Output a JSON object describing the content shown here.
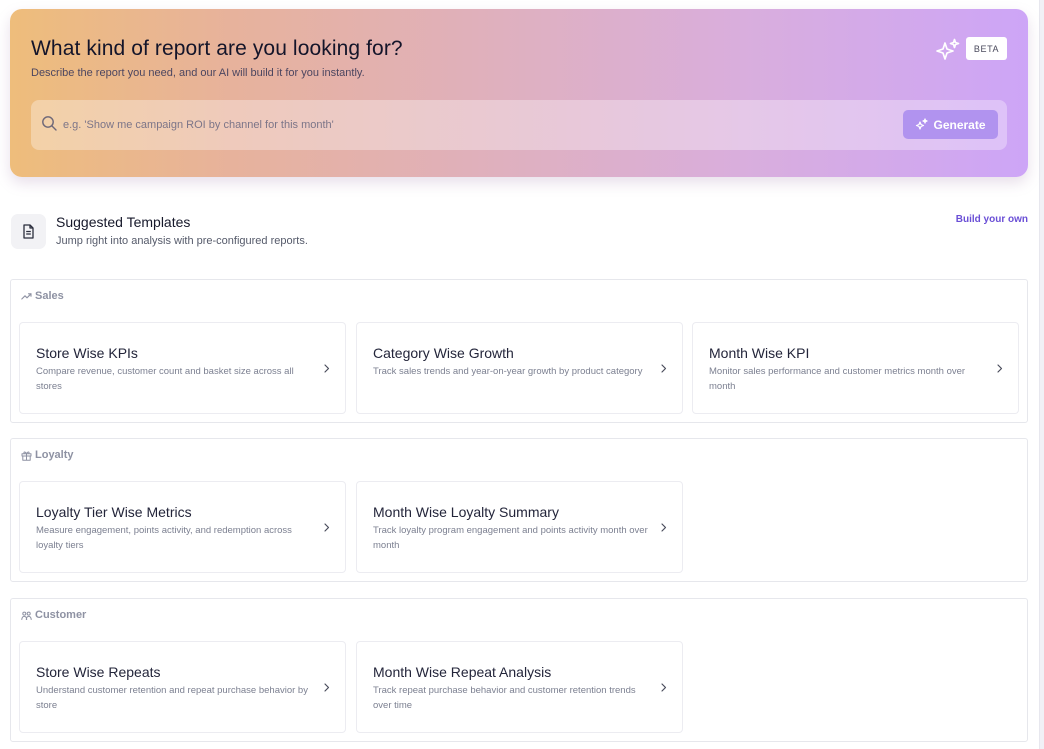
{
  "hero": {
    "title": "What kind of report are you looking for?",
    "subtitle": "Describe the report you need, and our AI will build it for you instantly.",
    "beta_label": "BETA",
    "search_placeholder": "e.g. 'Show me campaign ROI by channel for this month'",
    "generate_label": "Generate",
    "sparkle_icon": "sparkles-icon",
    "gradient_colors": [
      "#eebd7b",
      "#dfb0be",
      "#cda5f7"
    ],
    "button_color": "#b193ef"
  },
  "suggested": {
    "title": "Suggested Templates",
    "subtitle": "Jump right into analysis with pre-configured reports.",
    "build_label": "Build your own",
    "icon": "document-icon",
    "link_color": "#6a4fd6"
  },
  "sections": [
    {
      "label": "Sales",
      "icon": "trending-up-icon",
      "cards": [
        {
          "title": "Store Wise KPIs",
          "desc": "Compare revenue, customer count and basket size across all stores"
        },
        {
          "title": "Category Wise Growth",
          "desc": "Track sales trends and year-on-year growth by product category"
        },
        {
          "title": "Month Wise KPI",
          "desc": "Monitor sales performance and customer metrics month over month"
        }
      ]
    },
    {
      "label": "Loyalty",
      "icon": "gift-icon",
      "cards": [
        {
          "title": "Loyalty Tier Wise Metrics",
          "desc": "Measure engagement, points activity, and redemption across loyalty tiers"
        },
        {
          "title": "Month Wise Loyalty Summary",
          "desc": "Track loyalty program engagement and points activity month over month"
        }
      ]
    },
    {
      "label": "Customer",
      "icon": "users-icon",
      "cards": [
        {
          "title": "Store Wise Repeats",
          "desc": "Understand customer retention and repeat purchase behavior by store"
        },
        {
          "title": "Month Wise Repeat Analysis",
          "desc": "Track repeat purchase behavior and customer retention trends over time"
        }
      ]
    }
  ]
}
